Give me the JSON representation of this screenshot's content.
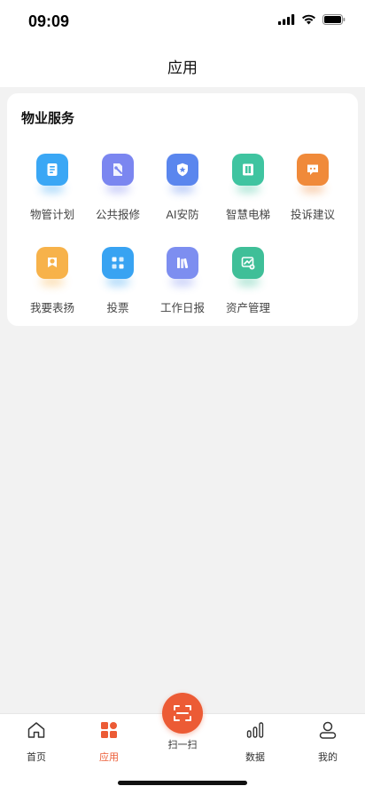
{
  "status_bar": {
    "time": "09:09",
    "icons": [
      "cellular-signal-icon",
      "wifi-icon",
      "battery-icon"
    ]
  },
  "header": {
    "title": "应用"
  },
  "property_services": {
    "title": "物业服务",
    "items": [
      {
        "label": "物管计划",
        "icon": "notebook-icon",
        "color": "#3aa7f5"
      },
      {
        "label": "公共报修",
        "icon": "wrench-doc-icon",
        "color": "#7b86f0"
      },
      {
        "label": "AI安防",
        "icon": "shield-star-icon",
        "color": "#5a86ee"
      },
      {
        "label": "智慧电梯",
        "icon": "elevator-icon",
        "color": "#3fc4a0"
      },
      {
        "label": "投诉建议",
        "icon": "chat-bubble-icon",
        "color": "#f08a3a"
      },
      {
        "label": "我要表扬",
        "icon": "award-ribbon-icon",
        "color": "#f7b24a"
      },
      {
        "label": "投票",
        "icon": "ballot-icon",
        "color": "#38a3f2"
      },
      {
        "label": "工作日报",
        "icon": "books-icon",
        "color": "#7d8ef0"
      },
      {
        "label": "资产管理",
        "icon": "asset-chart-icon",
        "color": "#3fbf98"
      }
    ]
  },
  "tabbar": {
    "accent": "#ec5b35",
    "items": [
      {
        "label": "首页",
        "icon": "home-icon",
        "active": false
      },
      {
        "label": "应用",
        "icon": "grid-apps-icon",
        "active": true
      },
      {
        "label": "扫一扫",
        "icon": "scan-icon",
        "active": false
      },
      {
        "label": "数据",
        "icon": "bar-chart-icon",
        "active": false
      },
      {
        "label": "我的",
        "icon": "user-icon",
        "active": false
      }
    ]
  }
}
